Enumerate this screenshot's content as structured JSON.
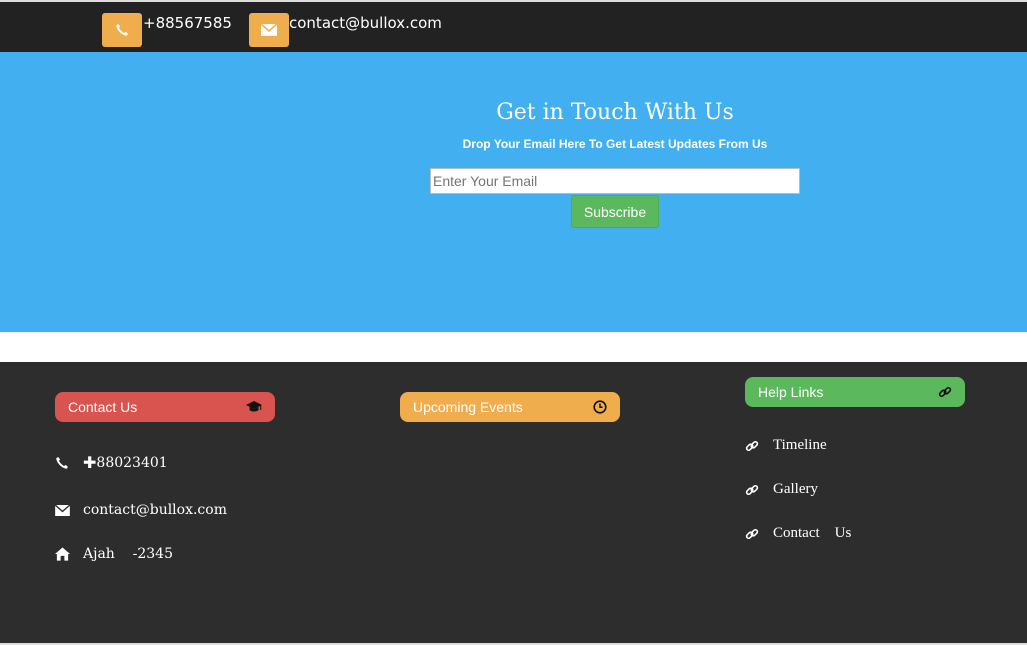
{
  "topbar": {
    "phone": "+88567585",
    "email": "contact@bullox.com",
    "accent_color": "#f0ad4e"
  },
  "hero": {
    "title": "Get in Touch With Us",
    "subtitle": "Drop Your Email Here To Get Latest Updates From Us",
    "email_placeholder": "Enter Your Email",
    "subscribe_label": "Subscribe",
    "background_color": "#41aff0"
  },
  "footer": {
    "contact": {
      "title": "Contact Us",
      "icon": "graduation-cap-icon",
      "phone_plus": "✚",
      "phone": "88023401",
      "email": "contact@bullox.com",
      "address": "Ajah    -2345"
    },
    "events": {
      "title": "Upcoming Events",
      "icon": "clock-icon"
    },
    "help": {
      "title": "Help Links",
      "icon": "link-icon",
      "links": [
        "Timeline",
        "Gallery",
        "Contact    Us"
      ]
    }
  }
}
